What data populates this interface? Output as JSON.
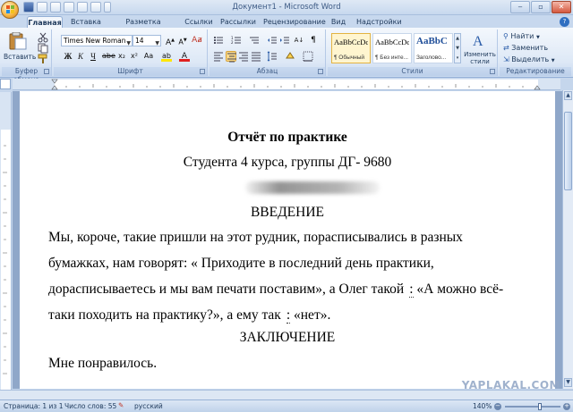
{
  "window": {
    "title": "Документ1 - Microsoft Word"
  },
  "tabs": [
    "Главная",
    "Вставка",
    "Разметка страницы",
    "Ссылки",
    "Рассылки",
    "Рецензирование",
    "Вид",
    "Надстройки"
  ],
  "ribbon": {
    "clipboard": {
      "paste_label": "Вставить",
      "group_label": "Буфер обмена"
    },
    "font": {
      "name": "Times New Roman",
      "size": "14",
      "group_label": "Шрифт",
      "bold": "Ж",
      "italic": "К",
      "underline": "Ч"
    },
    "paragraph": {
      "group_label": "Абзац"
    },
    "styles": {
      "group_label": "Стили",
      "items": [
        {
          "sample": "AaBbCcDc",
          "name": "¶ Обычный",
          "selected": true
        },
        {
          "sample": "AaBbCcDc",
          "name": "¶ Без инте...",
          "selected": false
        },
        {
          "sample": "AaBbC",
          "name": "Заголово...",
          "selected": false
        }
      ],
      "change_label": "Изменить стили"
    },
    "editing": {
      "group_label": "Редактирование",
      "find": "Найти",
      "replace": "Заменить",
      "select": "Выделить"
    }
  },
  "document": {
    "title": "Отчёт по практике",
    "subtitle": "Студента 4 курса, группы ДГ- 9680",
    "heading_intro": "ВВЕДЕНИЕ",
    "body_lines": [
      "Мы, короче, такие пришли на этот рудник, порасписывались в разных",
      "бумажках, нам говорят: « Приходите в последний день практики,",
      "дорасписываетесь и мы вам печати поставим», а Олег такой",
      "таки походить на практику?», а ему так",
      " «нет»."
    ],
    "line3_tail": " «А можно всё-",
    "colon": ":",
    "heading_conclusion": "ЗАКЛЮЧЕНИЕ",
    "conclusion": "Мне понравилось."
  },
  "status": {
    "page": "Страница: 1 из 1",
    "words": "Число слов: 55",
    "language": "русский",
    "zoom": "140%"
  },
  "watermark": "YAPLAKAL.COM"
}
